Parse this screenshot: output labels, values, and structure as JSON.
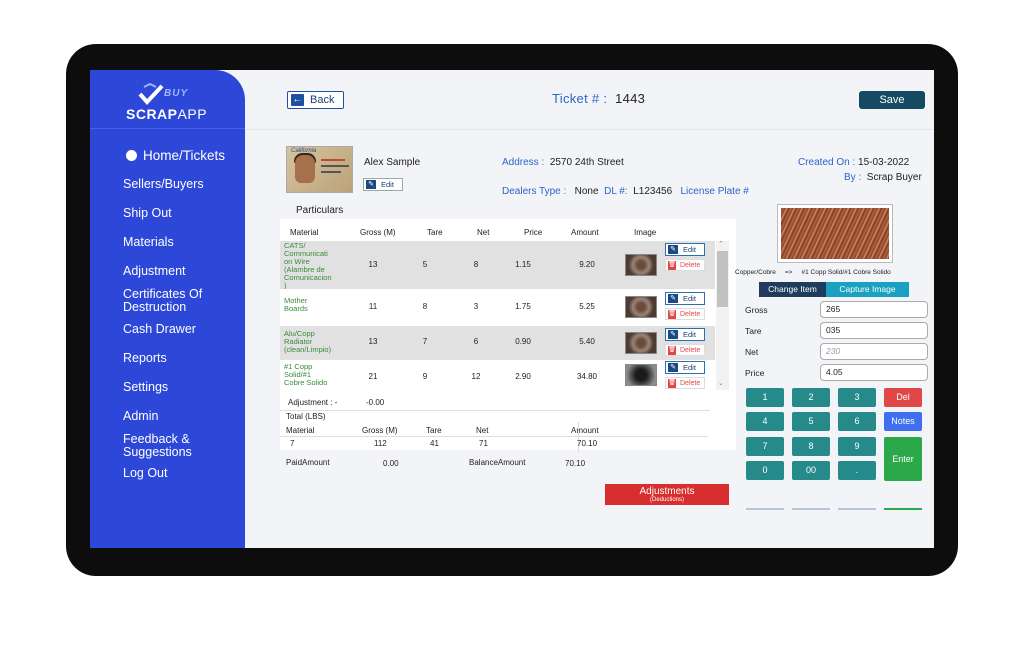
{
  "app": {
    "brand_top": "BUY",
    "brand_bold": "SCRAP",
    "brand_light": "APP"
  },
  "sidebar": {
    "items": [
      {
        "label": "Home/Tickets"
      },
      {
        "label": "Sellers/Buyers"
      },
      {
        "label": "Ship Out"
      },
      {
        "label": "Materials"
      },
      {
        "label": "Adjustment"
      },
      {
        "label": "Certificates Of\nDestruction"
      },
      {
        "label": "Cash Drawer"
      },
      {
        "label": "Reports"
      },
      {
        "label": "Settings"
      },
      {
        "label": "Admin"
      },
      {
        "label": "Feedback &\nSuggestions"
      },
      {
        "label": "Log Out"
      }
    ]
  },
  "header": {
    "back_label": "Back",
    "ticket_label": "Ticket # :",
    "ticket_number": "1443",
    "save_label": "Save"
  },
  "customer": {
    "name": "Alex Sample",
    "edit_label": "Edit",
    "id_state": "California",
    "address_label": "Address :",
    "address": "2570 24th Street",
    "dealers_type_label": "Dealers Type :",
    "dealers_type": "None",
    "dl_label": "DL #:",
    "dl": "L123456",
    "license_plate_label": "License Plate #",
    "created_label": "Created On :",
    "created_on": "15-03-2022",
    "by_label": "By :",
    "by": "Scrap Buyer"
  },
  "table": {
    "section_title": "Particulars",
    "headers": {
      "material": "Material",
      "gross": "Gross (M)",
      "tare": "Tare",
      "net": "Net",
      "price": "Price",
      "amount": "Amount",
      "image": "Image"
    },
    "edit_label": "Edit",
    "delete_label": "Delete",
    "rows": [
      {
        "material": "CATS/\nCommunicati\non Wire\n(Alambre de\nComunicacion\n)",
        "gross": "13",
        "tare": "5",
        "net": "8",
        "price": "1.15",
        "amount": "9.20"
      },
      {
        "material": "Mother\nBoards",
        "gross": "11",
        "tare": "8",
        "net": "3",
        "price": "1.75",
        "amount": "5.25"
      },
      {
        "material": "Alu/Copp\nRadiator\n(clean/Limpio)",
        "gross": "13",
        "tare": "7",
        "net": "6",
        "price": "0.90",
        "amount": "5.40"
      },
      {
        "material": "#1 Copp\nSolid/#1\nCobre Solido",
        "gross": "21",
        "tare": "9",
        "net": "12",
        "price": "2.90",
        "amount": "34.80"
      }
    ]
  },
  "summary": {
    "adjustment_label": "Adjustment : -",
    "adjustment_value": "-0.00",
    "total_label": "Total (LBS)",
    "headers": {
      "material": "Material",
      "gross": "Gross (M)",
      "tare": "Tare",
      "net": "Net",
      "amount": "Amount"
    },
    "totals": {
      "material": "7",
      "gross": "112",
      "tare": "41",
      "net": "71",
      "amount": "70.10"
    },
    "paid_label": "PaidAmount",
    "paid_value": "0.00",
    "balance_label": "BalanceAmount",
    "balance_value": "70.10",
    "adjustments_button": "Adjustments",
    "adjustments_sub": "(Deductions)"
  },
  "item_panel": {
    "item_left": "Copper/Cobre",
    "arrow": "=>",
    "item_right": "#1 Copp Solid/#1 Cobre Solido",
    "change_item_label": "Change Item",
    "capture_image_label": "Capture Image",
    "fields": {
      "gross_label": "Gross",
      "gross_value": "265",
      "tare_label": "Tare",
      "tare_value": "035",
      "net_label": "Net",
      "net_value": "230",
      "price_label": "Price",
      "price_value": "4.05"
    }
  },
  "keypad": {
    "k1": "1",
    "k2": "2",
    "k3": "3",
    "del": "Del",
    "k4": "4",
    "k5": "5",
    "k6": "6",
    "notes": "Notes",
    "k7": "7",
    "k8": "8",
    "k9": "9",
    "enter": "Enter",
    "k0": "0",
    "k00": "00",
    "dot": "."
  },
  "colors": {
    "sidebar": "#2d48d8",
    "key_teal": "#268a8a",
    "key_del": "#e04848",
    "key_notes": "#3f6ff0",
    "key_enter": "#2aa84a",
    "adjustments": "#d72f2f",
    "material_text": "#3a8a3a"
  }
}
